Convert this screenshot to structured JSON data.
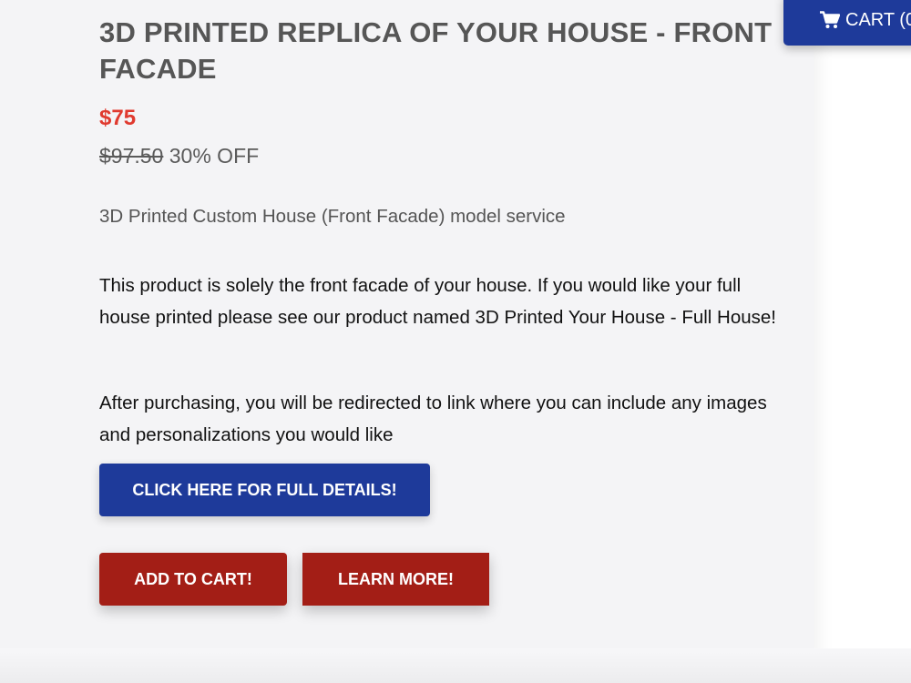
{
  "header": {
    "cart_label": "CART (0"
  },
  "product": {
    "title": "3D PRINTED REPLICA OF YOUR HOUSE - FRONT FACADE",
    "price": "$75",
    "original_price": "$97.50",
    "discount": "30% OFF",
    "subtitle": "3D Printed Custom House (Front Facade) model service",
    "description": [
      "This product is solely the front facade of your house. If you would like your full house printed please see our product named 3D Printed Your House - Full House!",
      "After purchasing, you will be redirected to link where you can include any images and personalizations you would like"
    ]
  },
  "buttons": {
    "details_label": "CLICK HERE FOR FULL DETAILS!",
    "add_to_cart_label": "ADD TO CART!",
    "learn_more_label": "LEARN MORE!"
  },
  "icons": {
    "cart": "cart-icon"
  },
  "colors": {
    "brand_blue": "#1e3a9a",
    "action_red": "#a31e16",
    "price_red": "#e03a2f",
    "panel_bg": "#f4f4f6"
  }
}
